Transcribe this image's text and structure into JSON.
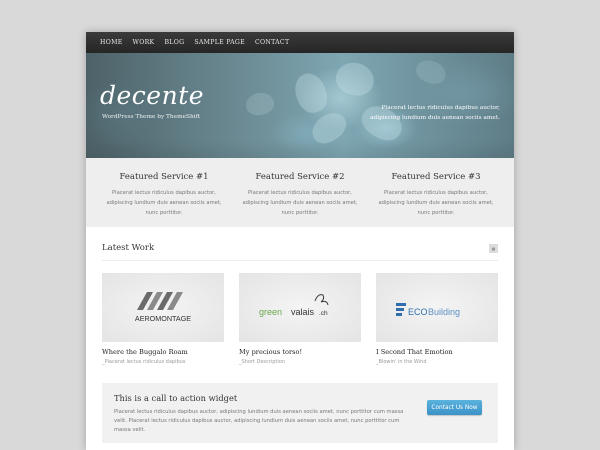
{
  "nav": {
    "items": [
      "HOME",
      "WORK",
      "BLOG",
      "SAMPLE PAGE",
      "CONTACT"
    ]
  },
  "hero": {
    "title": "decente",
    "subtitle": "WordPress Theme by ThemeShift",
    "text": "Placerat lectus ridiculus dapibus auctor, adipiscing lundium duis aenean sociis amet."
  },
  "services": [
    {
      "title": "Featured Service #1",
      "text": "Placerat lectus ridiculus dapibus auctor, adipiscing lundium duis aenean sociis amet, nunc porttitor."
    },
    {
      "title": "Featured Service #2",
      "text": "Placerat lectus ridiculus dapibus auctor, adipiscing lundium duis aenean sociis amet, nunc porttitor."
    },
    {
      "title": "Featured Service #3",
      "text": "Placerat lectus ridiculus dapibus auctor, adipiscing lundium duis aenean sociis amet, nunc porttitor."
    }
  ],
  "work": {
    "title": "Latest Work",
    "items": [
      {
        "title": "Where the Buggalo Roam",
        "sub": "_Placerat lectus ridiculus dapibus",
        "logo": "AEROMONTAGE"
      },
      {
        "title": "My precious torso!",
        "sub": "_Short Description",
        "logo_a": "green",
        "logo_b": "valais",
        "logo_c": ".ch"
      },
      {
        "title": "I Second That Emotion",
        "sub": "_Blowin' in the Wind",
        "logo_a": "ECO",
        "logo_b": "Building"
      }
    ]
  },
  "cta": {
    "title": "This is a call to action widget",
    "text": "Placerat lectus ridiculus dapibus auctor, adipiscing lundium duis aenean sociis amet, nunc porttitor cum massa velit. Placerat lectus ridiculus dapibus auctor, adipiscing lundium duis aenean sociis amet, nunc porttitor cum massa velit.",
    "button": "Contact Us Now"
  },
  "colors": {
    "accent": "#3b92c7",
    "nav_bg": "#2f2f2f",
    "hero": "#6f8f98"
  }
}
